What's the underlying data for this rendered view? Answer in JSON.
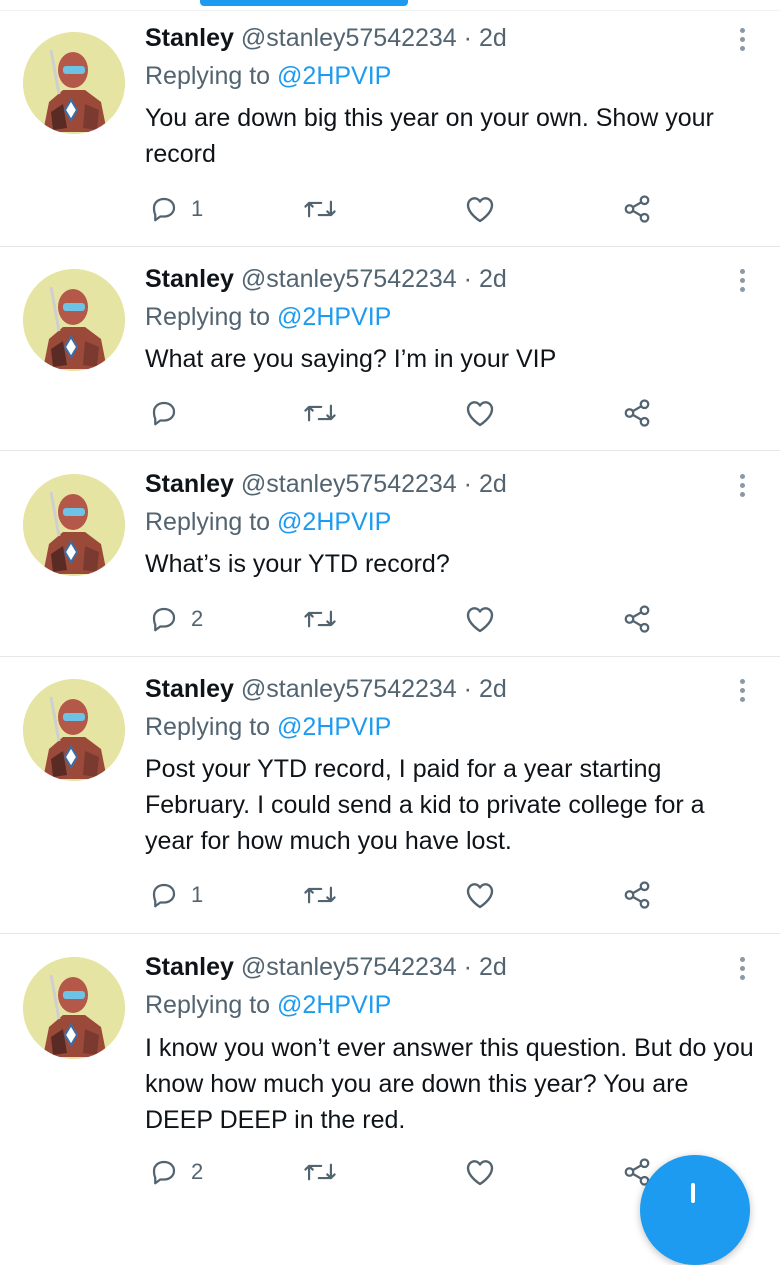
{
  "tweets": [
    {
      "name": "Stanley",
      "handle": "@stanley57542234",
      "time": "2d",
      "reply_prefix": "Replying to",
      "reply_to": "@2HPVIP",
      "text": "You are down big this year on your own. Show your record",
      "reply_count": "1"
    },
    {
      "name": "Stanley",
      "handle": "@stanley57542234",
      "time": "2d",
      "reply_prefix": "Replying to",
      "reply_to": "@2HPVIP",
      "text": "What are you saying? I’m in your VIP",
      "reply_count": ""
    },
    {
      "name": "Stanley",
      "handle": "@stanley57542234",
      "time": "2d",
      "reply_prefix": "Replying to",
      "reply_to": "@2HPVIP",
      "text": "What’s is your YTD record?",
      "reply_count": "2"
    },
    {
      "name": "Stanley",
      "handle": "@stanley57542234",
      "time": "2d",
      "reply_prefix": "Replying to",
      "reply_to": "@2HPVIP",
      "text": "Post your YTD record, I paid for a year starting February. I could send a kid to private college for a year for how much you have lost.",
      "reply_count": "1"
    },
    {
      "name": "Stanley",
      "handle": "@stanley57542234",
      "time": "2d",
      "reply_prefix": "Replying to",
      "reply_to": "@2HPVIP",
      "text": "I know you won’t ever answer this question. But do you know how much you are down this year? You are DEEP DEEP in the red.",
      "reply_count": "2"
    }
  ],
  "icons": {
    "reply": "reply-icon",
    "retweet": "retweet-icon",
    "like": "heart-icon",
    "share": "share-icon",
    "more": "more-vertical-icon",
    "compose": "compose-icon"
  },
  "colors": {
    "accent": "#1d9bf0",
    "secondary_text": "#536471",
    "avatar_bg": "#e6e4a2"
  }
}
